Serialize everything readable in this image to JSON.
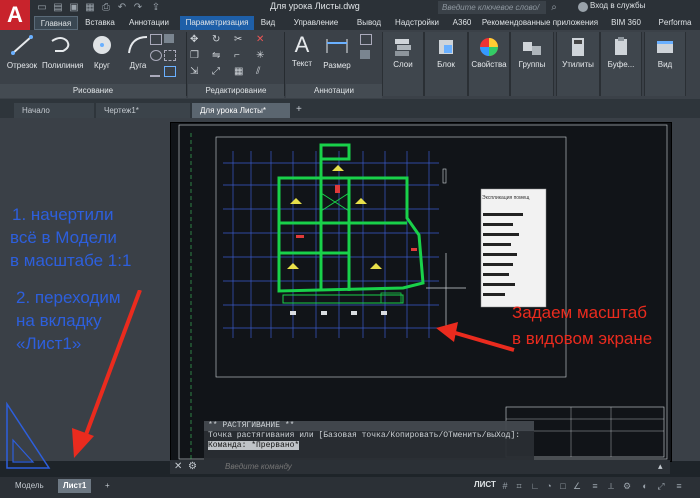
{
  "titlebar": {
    "document_title": "Для урока Листы.dwg",
    "search_placeholder": "Введите ключевое слово/фразу",
    "signin_label": "Вход в службы",
    "account_label": "Performa"
  },
  "ribbon_tabs": [
    "Главная",
    "Вставка",
    "Аннотации",
    "Параметризация",
    "Вид",
    "Управление",
    "Вывод",
    "Надстройки",
    "A360",
    "Рекомендованные приложения",
    "BIM 360",
    "Performa"
  ],
  "draw_panel": {
    "title": "Рисование",
    "tools": [
      "Отрезок",
      "Полилиния",
      "Круг",
      "Дуга"
    ]
  },
  "modify_panel": {
    "title": "Редактирование"
  },
  "annotation_panel": {
    "title": "Аннотации",
    "tools": [
      "Текст",
      "Размер"
    ]
  },
  "right_tools": {
    "layers": "Слои",
    "block": "Блок",
    "properties": "Свойства",
    "groups": "Группы",
    "utilities": "Утилиты",
    "clipboard": "Буфе...",
    "view": "Вид"
  },
  "doc_tabs": [
    "Начало",
    "Чертеж1*",
    "Для урока Листы*"
  ],
  "command": {
    "header": "** РАСТЯГИВАНИЕ **",
    "line1": "Точка растягивания или [Базовая точка/Копировать/ОТменить/выХод]:",
    "line2": "Команда: *Прервано*",
    "placeholder": "Введите команду"
  },
  "layout_tabs": [
    "Модель",
    "Лист1",
    "+"
  ],
  "status": {
    "space_label": "ЛИСТ"
  },
  "annotations": {
    "left_line1": "1. начертили",
    "left_line2": "всё в Модели",
    "left_line3": "в масштабе 1:1",
    "left_line4": "2. переходим",
    "left_line5": "на вкладку",
    "left_line6": "«Лист1»",
    "right_line1": "Задаем масштаб",
    "right_line2": "в видовом экране"
  },
  "table_title": "Экспликация помещ"
}
